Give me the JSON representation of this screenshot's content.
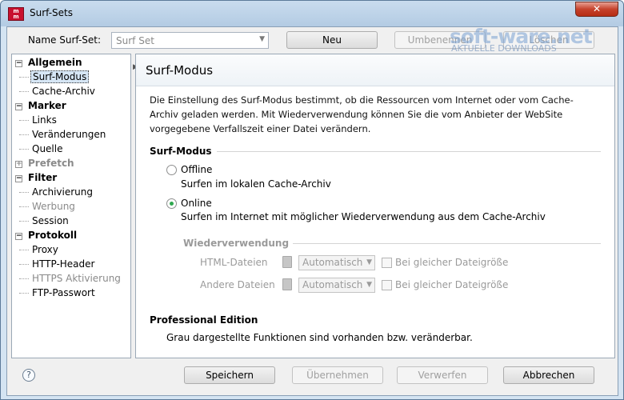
{
  "window": {
    "title": "Surf-Sets",
    "close_glyph": "✕",
    "app_icon": "app-logo-icon"
  },
  "setbar": {
    "label": "Name Surf-Set:",
    "combo_value": "Surf Set",
    "new_label": "Neu",
    "rename_label": "Umbenennen",
    "delete_label": "Löschen"
  },
  "watermark": {
    "main": "soft-ware.net",
    "sub": "AKTUELLE DOWNLOADS"
  },
  "tree": {
    "items": [
      {
        "label": "Allgemein",
        "group": true,
        "expander": "−"
      },
      {
        "label": "Surf-Modus"
      },
      {
        "label": "Cache-Archiv"
      },
      {
        "label": "Marker",
        "group": true
      },
      {
        "label": "Links"
      },
      {
        "label": "Veränderungen"
      },
      {
        "label": "Quelle"
      },
      {
        "label": "Prefetch",
        "group": true,
        "expander": "+"
      },
      {
        "label": "Filter",
        "group": true,
        "expander": "−"
      },
      {
        "label": "Archivierung"
      },
      {
        "label": "Werbung"
      },
      {
        "label": "Session"
      },
      {
        "label": "Protokoll",
        "group": true,
        "expander": "−"
      },
      {
        "label": "Proxy"
      },
      {
        "label": "HTTP-Header"
      },
      {
        "label": "HTTPS Aktivierung"
      },
      {
        "label": "FTP-Passwort"
      }
    ]
  },
  "panel": {
    "title": "Surf-Modus",
    "description": "Die Einstellung des Surf-Modus bestimmt, ob die Ressourcen vom Internet oder vom Cache-Archiv geladen werden. Mit Wiederverwendung können Sie die vom Anbieter der WebSite vorgegebene Verfallszeit einer Datei verändern.",
    "mode_section": "Surf-Modus",
    "offline_label": "Offline",
    "offline_desc": "Surfen im lokalen Cache-Archiv",
    "online_label": "Online",
    "online_desc": "Surfen im Internet mit möglicher Wiederverwendung aus dem Cache-Archiv",
    "reuse_section": "Wiederverwendung",
    "html_label": "HTML-Dateien",
    "html_value": "Automatisch",
    "html_check": "Bei gleicher Dateigröße",
    "other_label": "Andere Dateien",
    "other_value": "Automatisch",
    "other_check": "Bei gleicher Dateigröße",
    "pro_section": "Professional Edition",
    "pro_desc": "Grau dargestellte Funktionen sind vorhanden bzw. veränderbar."
  },
  "footer": {
    "help_glyph": "?",
    "save_label": "Speichern",
    "apply_label": "Übernehmen",
    "discard_label": "Verwerfen",
    "cancel_label": "Abbrechen"
  },
  "selected_mode": "Online",
  "colors": {
    "accent_green": "#2fa84f",
    "close_red": "#c6422c",
    "app_icon_red": "#c8102e"
  }
}
